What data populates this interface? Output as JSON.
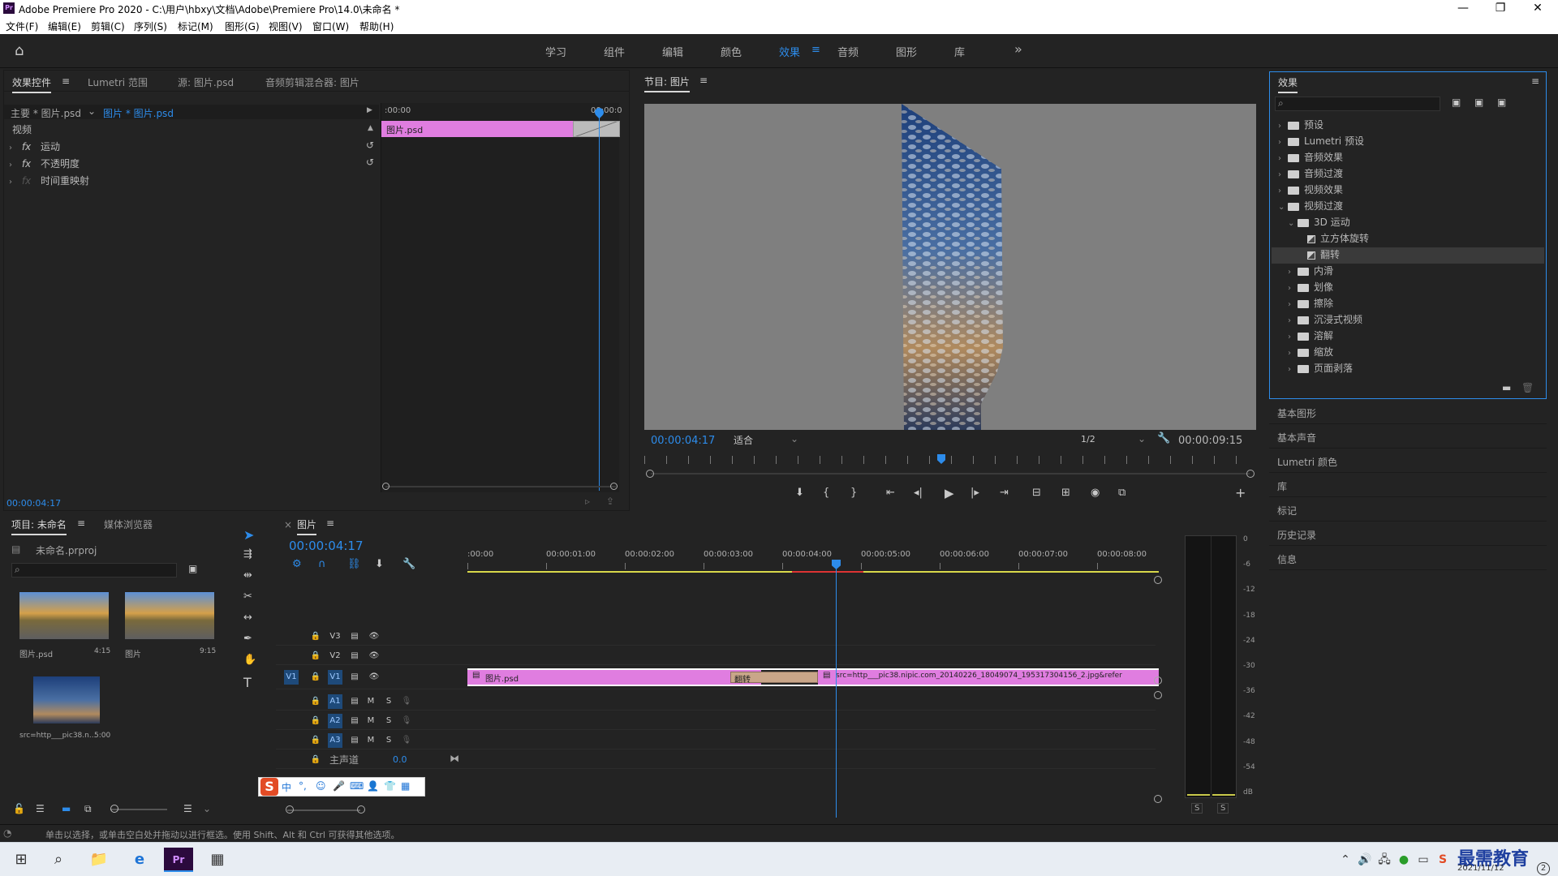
{
  "window": {
    "title": "Adobe Premiere Pro 2020 - C:\\用户\\hbxy\\文档\\Adobe\\Premiere Pro\\14.0\\未命名 *",
    "logo": "Pr",
    "minimize": "—",
    "maximize": "❐",
    "close": "✕"
  },
  "menu": [
    "文件(F)",
    "编辑(E)",
    "剪辑(C)",
    "序列(S)",
    "标记(M)",
    "图形(G)",
    "视图(V)",
    "窗口(W)",
    "帮助(H)"
  ],
  "workspaces": [
    "学习",
    "组件",
    "编辑",
    "颜色",
    "效果",
    "音频",
    "图形",
    "库"
  ],
  "workspace_active": "效果",
  "workspace_more": "»",
  "effect_controls": {
    "tabs": [
      "效果控件",
      "Lumetri 范围",
      "源: 图片.psd",
      "音频剪辑混合器: 图片"
    ],
    "master_clip": "主要 * 图片.psd",
    "sequence_clip": "图片 * 图片.psd",
    "section": "视频",
    "effects": [
      "运动",
      "不透明度",
      "时间重映射"
    ],
    "ruler_start": ":00:00",
    "ruler_end": "00:00:0",
    "clip_name": "图片.psd",
    "timecode": "00:00:04:17"
  },
  "program_monitor": {
    "title": "节目: 图片",
    "timecode": "00:00:04:17",
    "fit": "适合",
    "resolution": "1/2",
    "duration": "00:00:09:15"
  },
  "effects_panel": {
    "title": "效果",
    "search_placeholder": "",
    "tree": [
      {
        "label": "预设",
        "level": 0,
        "expanded": false
      },
      {
        "label": "Lumetri 预设",
        "level": 0,
        "expanded": false
      },
      {
        "label": "音频效果",
        "level": 0,
        "expanded": false
      },
      {
        "label": "音频过渡",
        "level": 0,
        "expanded": false
      },
      {
        "label": "视频效果",
        "level": 0,
        "expanded": false
      },
      {
        "label": "视频过渡",
        "level": 0,
        "expanded": true
      },
      {
        "label": "3D 运动",
        "level": 1,
        "expanded": true
      },
      {
        "label": "立方体旋转",
        "level": 2,
        "item": true
      },
      {
        "label": "翻转",
        "level": 2,
        "item": true,
        "selected": true
      },
      {
        "label": "内滑",
        "level": 1,
        "expanded": false
      },
      {
        "label": "划像",
        "level": 1,
        "expanded": false
      },
      {
        "label": "擦除",
        "level": 1,
        "expanded": false
      },
      {
        "label": "沉浸式视频",
        "level": 1,
        "expanded": false
      },
      {
        "label": "溶解",
        "level": 1,
        "expanded": false
      },
      {
        "label": "缩放",
        "level": 1,
        "expanded": false
      },
      {
        "label": "页面剥落",
        "level": 1,
        "expanded": false
      }
    ],
    "collapsed_panels": [
      "基本图形",
      "基本声音",
      "Lumetri 颜色",
      "库",
      "标记",
      "历史记录",
      "信息"
    ]
  },
  "project": {
    "tabs": [
      "项目: 未命名",
      "媒体浏览器"
    ],
    "file": "未命名.prproj",
    "items": [
      {
        "name": "图片.psd",
        "duration": "4:15"
      },
      {
        "name": "图片",
        "duration": "9:15"
      },
      {
        "name": "src=http___pic38.n...",
        "duration": "5:00"
      }
    ]
  },
  "timeline": {
    "title": "图片",
    "close": "×",
    "timecode": "00:00:04:17",
    "ruler": [
      ":00:00",
      "00:00:01:00",
      "00:00:02:00",
      "00:00:03:00",
      "00:00:04:00",
      "00:00:05:00",
      "00:00:06:00",
      "00:00:07:00",
      "00:00:08:00"
    ],
    "video_tracks": [
      "V3",
      "V2",
      "V1"
    ],
    "audio_tracks": [
      "A1",
      "A2",
      "A3"
    ],
    "source_patch": "V1",
    "master": "主声道",
    "master_value": "0.0",
    "clip1": "图片.psd",
    "transition": "翻转",
    "clip2": "src=http___pic38.nipic.com_20140226_18049074_195317304156_2.jpg&refer",
    "mute": "M",
    "solo": "S"
  },
  "meter": {
    "labels": [
      "0",
      "-6",
      "-12",
      "-18",
      "-24",
      "-30",
      "-36",
      "-42",
      "-48",
      "-54",
      "dB"
    ],
    "solo_left": "S",
    "solo_right": "S"
  },
  "status_bar": "单击以选择，或单击空白处并拖动以进行框选。使用 Shift、Alt 和 Ctrl 可获得其他选项。",
  "watermark": "最需教育",
  "taskbar": {
    "date": "2021/11/12",
    "badge": "2"
  },
  "ime": [
    "中",
    "°,",
    "☺",
    "🎤",
    "⌨",
    "👤",
    "👕",
    "▦"
  ]
}
